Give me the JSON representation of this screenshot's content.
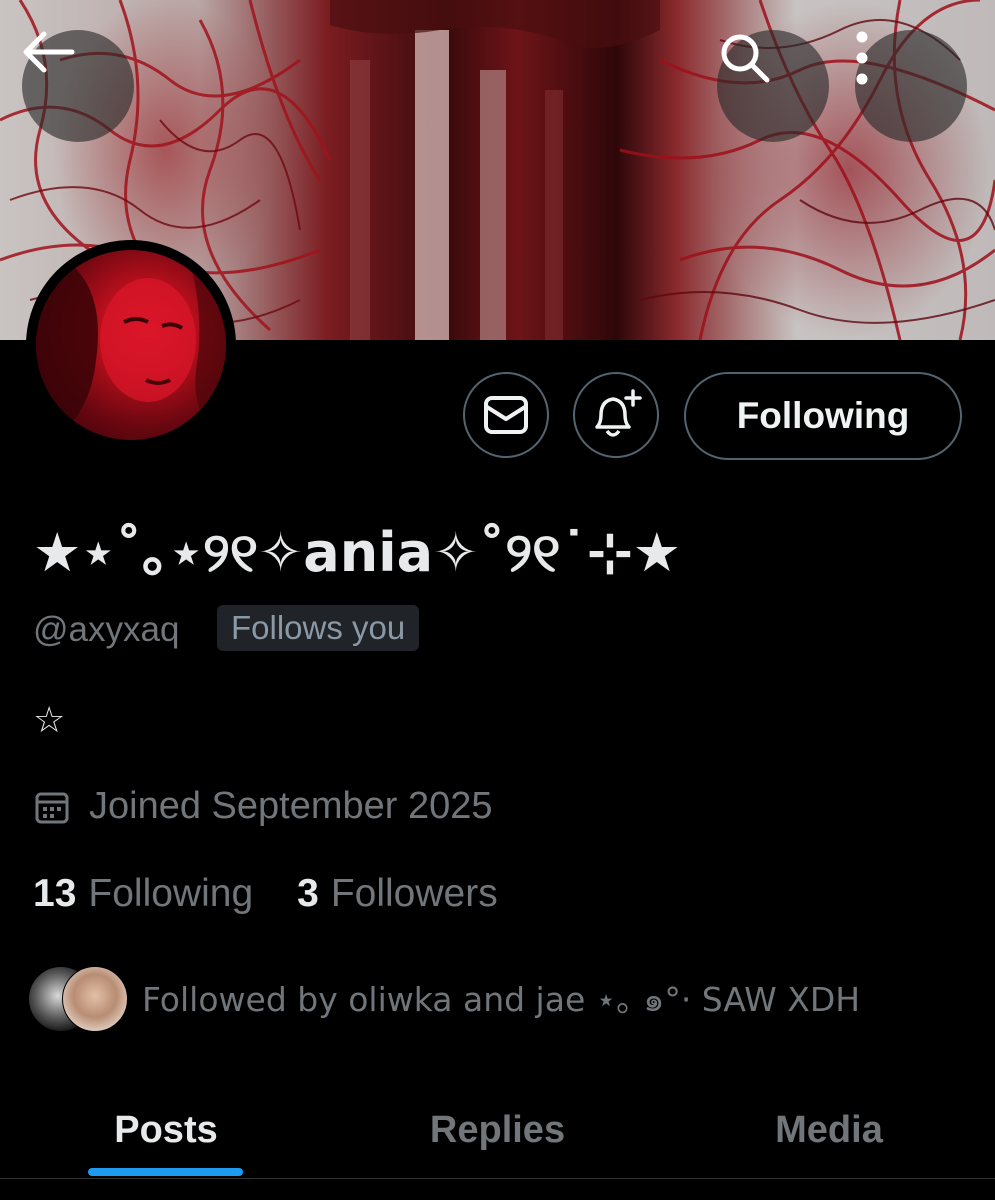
{
  "header": {
    "back_icon": "arrow-left-icon",
    "search_icon": "search-icon",
    "more_icon": "more-vertical-icon"
  },
  "actions": {
    "message_icon": "envelope-icon",
    "notify_icon": "bell-plus-icon",
    "following_label": "Following"
  },
  "profile": {
    "display_name": "★⋆˚｡⋆୨୧✧ania✧˚୨୧˙⊹★",
    "handle": "@axyxaq",
    "follows_you_badge": "Follows you",
    "bio": "☆",
    "joined": "Joined September 2025",
    "joined_icon": "calendar-icon",
    "following_count": "13",
    "following_label": "Following",
    "followers_count": "3",
    "followers_label": "Followers",
    "followed_by": "Followed by oliwka and jae ⋆｡ ๑°· SAW XDH"
  },
  "tabs": [
    {
      "label": "Posts",
      "active": true
    },
    {
      "label": "Replies",
      "active": false
    },
    {
      "label": "Media",
      "active": false
    }
  ],
  "colors": {
    "background": "#000000",
    "text_primary": "#e7e9ea",
    "text_secondary": "#71767b",
    "border": "#536471",
    "accent": "#1d9bf0"
  }
}
